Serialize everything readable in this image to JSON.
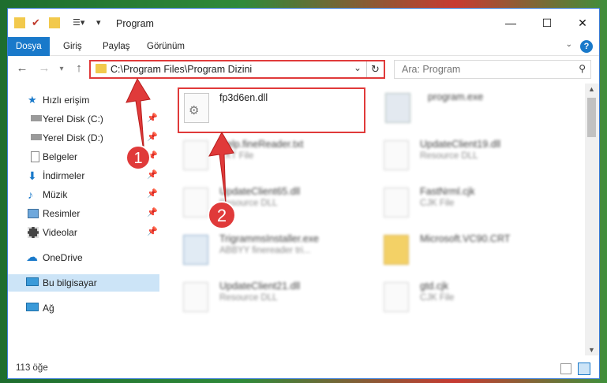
{
  "window": {
    "title": "Program",
    "close_icon": "close-icon",
    "minimize_icon": "minimize-icon",
    "maximize_icon": "maximize-icon"
  },
  "ribbon": {
    "tabs": [
      {
        "label": "Dosya",
        "active": true
      },
      {
        "label": "Giriş"
      },
      {
        "label": "Paylaş"
      },
      {
        "label": "Görünüm"
      }
    ],
    "help": "?"
  },
  "address": {
    "path": "C:\\Program Files\\Program Dizini"
  },
  "search": {
    "placeholder": "Ara: Program"
  },
  "sidebar": {
    "items": [
      {
        "label": "Hızlı erişim",
        "icon": "star-icon"
      },
      {
        "label": "Yerel Disk (C:)",
        "icon": "drive-icon",
        "pinned": true
      },
      {
        "label": "Yerel Disk (D:)",
        "icon": "drive-icon",
        "pinned": true
      },
      {
        "label": "Belgeler",
        "icon": "document-icon",
        "pinned": true
      },
      {
        "label": "İndirmeler",
        "icon": "download-icon",
        "pinned": true
      },
      {
        "label": "Müzik",
        "icon": "music-icon",
        "pinned": true
      },
      {
        "label": "Resimler",
        "icon": "pictures-icon",
        "pinned": true
      },
      {
        "label": "Videolar",
        "icon": "video-icon",
        "pinned": true
      },
      {
        "label": "OneDrive",
        "icon": "cloud-icon"
      },
      {
        "label": "Bu bilgisayar",
        "icon": "computer-icon",
        "selected": true
      },
      {
        "label": "Ağ",
        "icon": "network-icon"
      }
    ]
  },
  "files": [
    {
      "name": "fp3d6en.dll",
      "type": "",
      "highlighted": true
    },
    {
      "name": "program.exe",
      "type": ""
    },
    {
      "name": "Help.fineReader.txt",
      "type": "TXT File"
    },
    {
      "name": "UpdateClient19.dll",
      "type": "Resource DLL"
    },
    {
      "name": "UpdateClient65.dll",
      "type": "Resource DLL"
    },
    {
      "name": "FastNrml.cjk",
      "type": "CJK File"
    },
    {
      "name": "TrigrammsInstaller.exe",
      "type": "ABBYY finereader tri..."
    },
    {
      "name": "Microsoft.VC90.CRT",
      "type": ""
    },
    {
      "name": "UpdateClient21.dll",
      "type": "Resource DLL"
    },
    {
      "name": "gtd.cjk",
      "type": "CJK File"
    }
  ],
  "status": {
    "count": "113 öğe"
  },
  "annotations": {
    "step1": "1",
    "step2": "2",
    "highlight_color": "#e03a3a"
  }
}
